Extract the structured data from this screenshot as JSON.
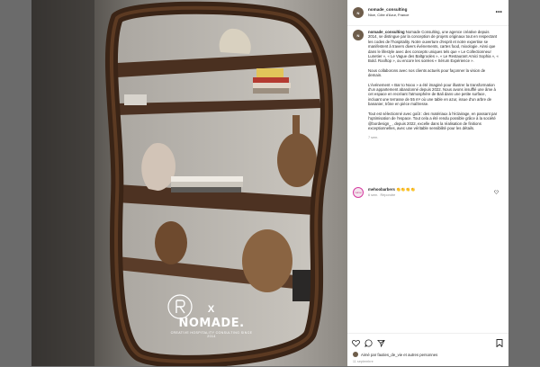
{
  "post": {
    "username": "nomade_consulting",
    "location": "Nice, Côte d'Azur, France",
    "avatar_initials": "N",
    "more_label": "•••",
    "caption_paragraphs": [
      "Nomade Consulting, une agence créative depuis 2014, se distingue par la conception de projets originaux tout en respectant les codes de l'hospitality. Notre ouverture d'esprit et notre expertise se manifestent à travers divers événements, cartes food, mixologie. Ainsi que dans le lifestyle avec des concepts uniques tels que « Le Collectionneur Lunetier », « Le Vague des Baltgrooles », « Le Restaurant Amici Sophia », « Bold. Rooftop », ou encore les soirées « Sérum Expérience ».",
      "Nous collaborons avec nos clients actuels pour façonner la vision de demain.",
      "L'événement « Bar to Nooo » a été imaginé pour illustrer la transformation d'un appartement abandonné depuis 2022. Nous avons insufflé une âme à cet espace en recréant l'atmosphère de Bali dans une petite surface, incluant une terrasse de 55 m² où une table en azur, issue d'un arbre de bananier, trône en pièce maîtresse.",
      "Tout est sélectionné avec goût : des matériaux à l'éclairage, en passant par l'optimisation de l'espace. Tout cela a été rendu possible grâce à la société @bordesign_ , depuis 2022, excelle dans la réalisation de finitions exceptionnelles, avec une véritable sensibilité pour les détails."
    ],
    "caption_time": "7 sem.",
    "likes_text": "Aimé par fauties_de_vie et autres personnes",
    "date": "11 septembre",
    "brand": {
      "x": "X",
      "name": "NOMADE.",
      "tagline": "CREATIVE HOSPITALITY CONSULTING SINCE 2014"
    }
  },
  "comment": {
    "username": "mehoobarbers",
    "text": "👏👏👏👏",
    "time": "6 sem.",
    "reply_label": "Répondre",
    "avatar_text": "mehoo"
  },
  "colors": {
    "wood": "#3a2416",
    "wall": "#b7b3ad",
    "white": "#ffffff"
  }
}
